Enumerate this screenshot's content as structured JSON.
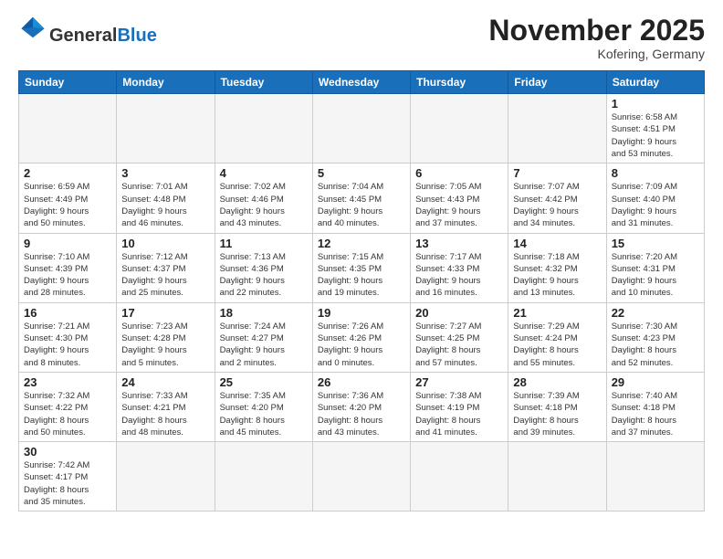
{
  "header": {
    "logo_general": "General",
    "logo_blue": "Blue",
    "month_title": "November 2025",
    "subtitle": "Kofering, Germany"
  },
  "weekdays": [
    "Sunday",
    "Monday",
    "Tuesday",
    "Wednesday",
    "Thursday",
    "Friday",
    "Saturday"
  ],
  "weeks": [
    [
      {
        "day": "",
        "info": ""
      },
      {
        "day": "",
        "info": ""
      },
      {
        "day": "",
        "info": ""
      },
      {
        "day": "",
        "info": ""
      },
      {
        "day": "",
        "info": ""
      },
      {
        "day": "",
        "info": ""
      },
      {
        "day": "1",
        "info": "Sunrise: 6:58 AM\nSunset: 4:51 PM\nDaylight: 9 hours\nand 53 minutes."
      }
    ],
    [
      {
        "day": "2",
        "info": "Sunrise: 6:59 AM\nSunset: 4:49 PM\nDaylight: 9 hours\nand 50 minutes."
      },
      {
        "day": "3",
        "info": "Sunrise: 7:01 AM\nSunset: 4:48 PM\nDaylight: 9 hours\nand 46 minutes."
      },
      {
        "day": "4",
        "info": "Sunrise: 7:02 AM\nSunset: 4:46 PM\nDaylight: 9 hours\nand 43 minutes."
      },
      {
        "day": "5",
        "info": "Sunrise: 7:04 AM\nSunset: 4:45 PM\nDaylight: 9 hours\nand 40 minutes."
      },
      {
        "day": "6",
        "info": "Sunrise: 7:05 AM\nSunset: 4:43 PM\nDaylight: 9 hours\nand 37 minutes."
      },
      {
        "day": "7",
        "info": "Sunrise: 7:07 AM\nSunset: 4:42 PM\nDaylight: 9 hours\nand 34 minutes."
      },
      {
        "day": "8",
        "info": "Sunrise: 7:09 AM\nSunset: 4:40 PM\nDaylight: 9 hours\nand 31 minutes."
      }
    ],
    [
      {
        "day": "9",
        "info": "Sunrise: 7:10 AM\nSunset: 4:39 PM\nDaylight: 9 hours\nand 28 minutes."
      },
      {
        "day": "10",
        "info": "Sunrise: 7:12 AM\nSunset: 4:37 PM\nDaylight: 9 hours\nand 25 minutes."
      },
      {
        "day": "11",
        "info": "Sunrise: 7:13 AM\nSunset: 4:36 PM\nDaylight: 9 hours\nand 22 minutes."
      },
      {
        "day": "12",
        "info": "Sunrise: 7:15 AM\nSunset: 4:35 PM\nDaylight: 9 hours\nand 19 minutes."
      },
      {
        "day": "13",
        "info": "Sunrise: 7:17 AM\nSunset: 4:33 PM\nDaylight: 9 hours\nand 16 minutes."
      },
      {
        "day": "14",
        "info": "Sunrise: 7:18 AM\nSunset: 4:32 PM\nDaylight: 9 hours\nand 13 minutes."
      },
      {
        "day": "15",
        "info": "Sunrise: 7:20 AM\nSunset: 4:31 PM\nDaylight: 9 hours\nand 10 minutes."
      }
    ],
    [
      {
        "day": "16",
        "info": "Sunrise: 7:21 AM\nSunset: 4:30 PM\nDaylight: 9 hours\nand 8 minutes."
      },
      {
        "day": "17",
        "info": "Sunrise: 7:23 AM\nSunset: 4:28 PM\nDaylight: 9 hours\nand 5 minutes."
      },
      {
        "day": "18",
        "info": "Sunrise: 7:24 AM\nSunset: 4:27 PM\nDaylight: 9 hours\nand 2 minutes."
      },
      {
        "day": "19",
        "info": "Sunrise: 7:26 AM\nSunset: 4:26 PM\nDaylight: 9 hours\nand 0 minutes."
      },
      {
        "day": "20",
        "info": "Sunrise: 7:27 AM\nSunset: 4:25 PM\nDaylight: 8 hours\nand 57 minutes."
      },
      {
        "day": "21",
        "info": "Sunrise: 7:29 AM\nSunset: 4:24 PM\nDaylight: 8 hours\nand 55 minutes."
      },
      {
        "day": "22",
        "info": "Sunrise: 7:30 AM\nSunset: 4:23 PM\nDaylight: 8 hours\nand 52 minutes."
      }
    ],
    [
      {
        "day": "23",
        "info": "Sunrise: 7:32 AM\nSunset: 4:22 PM\nDaylight: 8 hours\nand 50 minutes."
      },
      {
        "day": "24",
        "info": "Sunrise: 7:33 AM\nSunset: 4:21 PM\nDaylight: 8 hours\nand 48 minutes."
      },
      {
        "day": "25",
        "info": "Sunrise: 7:35 AM\nSunset: 4:20 PM\nDaylight: 8 hours\nand 45 minutes."
      },
      {
        "day": "26",
        "info": "Sunrise: 7:36 AM\nSunset: 4:20 PM\nDaylight: 8 hours\nand 43 minutes."
      },
      {
        "day": "27",
        "info": "Sunrise: 7:38 AM\nSunset: 4:19 PM\nDaylight: 8 hours\nand 41 minutes."
      },
      {
        "day": "28",
        "info": "Sunrise: 7:39 AM\nSunset: 4:18 PM\nDaylight: 8 hours\nand 39 minutes."
      },
      {
        "day": "29",
        "info": "Sunrise: 7:40 AM\nSunset: 4:18 PM\nDaylight: 8 hours\nand 37 minutes."
      }
    ],
    [
      {
        "day": "30",
        "info": "Sunrise: 7:42 AM\nSunset: 4:17 PM\nDaylight: 8 hours\nand 35 minutes."
      },
      {
        "day": "",
        "info": ""
      },
      {
        "day": "",
        "info": ""
      },
      {
        "day": "",
        "info": ""
      },
      {
        "day": "",
        "info": ""
      },
      {
        "day": "",
        "info": ""
      },
      {
        "day": "",
        "info": ""
      }
    ]
  ]
}
